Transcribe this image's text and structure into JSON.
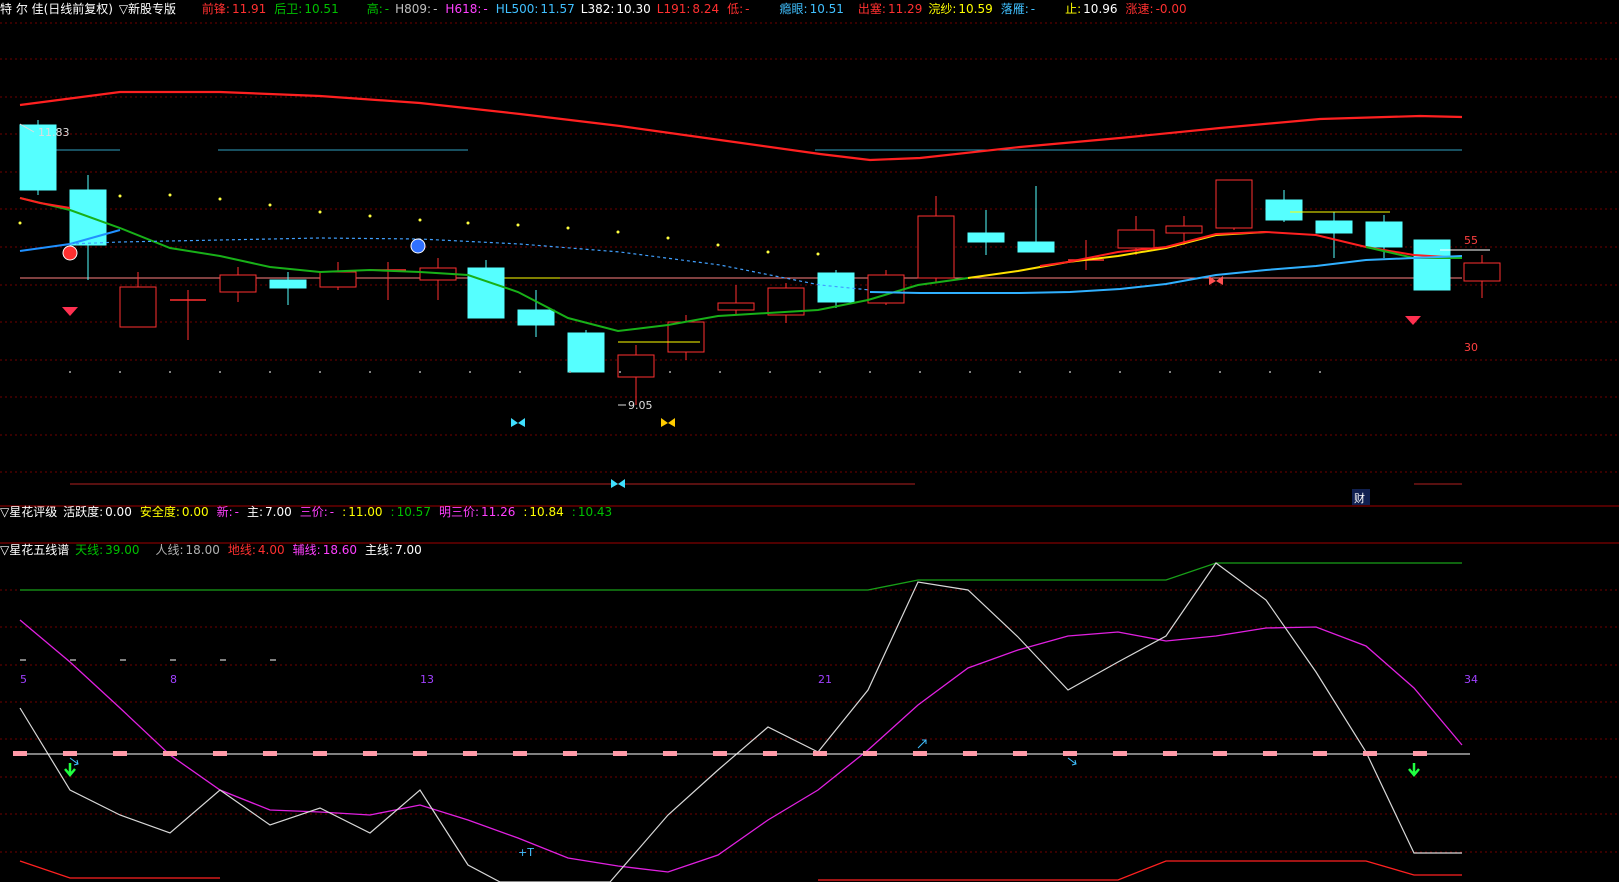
{
  "top_bar": {
    "title": "特 尔 佳(日线前复权)",
    "mode": "▽新股专版",
    "items": [
      {
        "label": "前锋:",
        "value": "11.91",
        "lc": "#ff3030",
        "vc": "#ff3030"
      },
      {
        "label": "后卫:",
        "value": "10.51",
        "lc": "#00c000",
        "vc": "#00c000"
      },
      {
        "label": "高:",
        "value": "-",
        "lc": "#00c000",
        "vc": "#00c000"
      },
      {
        "label": "H809:",
        "value": "-",
        "lc": "#c0c0c0",
        "vc": "#c0c0c0"
      },
      {
        "label": "H618:",
        "value": "-",
        "lc": "#ff40ff",
        "vc": "#ff40ff"
      },
      {
        "label": "HL500:",
        "value": "11.57",
        "lc": "#40c0ff",
        "vc": "#40c0ff"
      },
      {
        "label": "L382:",
        "value": "10.30",
        "lc": "#ffffff",
        "vc": "#ffffff"
      },
      {
        "label": "L191:",
        "value": "8.24",
        "lc": "#ff3030",
        "vc": "#ff3030"
      },
      {
        "label": "低:",
        "value": "-",
        "lc": "#ff3030",
        "vc": "#ff3030"
      },
      {
        "label": "瘾眼:",
        "value": "10.51",
        "lc": "#40c0ff",
        "vc": "#40c0ff"
      },
      {
        "label": "出塞:",
        "value": "11.29",
        "lc": "#ff3030",
        "vc": "#ff3030"
      },
      {
        "label": "浣纱:",
        "value": "10.59",
        "lc": "#ffff00",
        "vc": "#ffff00"
      },
      {
        "label": "落雁:",
        "value": "-",
        "lc": "#40c0ff",
        "vc": "#40c0ff"
      },
      {
        "label": "止:",
        "value": "10.96",
        "lc": "#ffff00",
        "vc": "#ffffff"
      },
      {
        "label": "涨速:",
        "value": "-0.00",
        "lc": "#ff3030",
        "vc": "#ff3030"
      }
    ]
  },
  "main_chart": {
    "high_label": "11.83",
    "low_label": "9.05",
    "right_scale_upper": "55",
    "right_scale_lower": "30",
    "cai_marker": "财"
  },
  "pane1": {
    "title": "▽星花评级",
    "items": [
      {
        "label": "活跃度:",
        "value": "0.00",
        "lc": "#ffffff",
        "vc": "#ffffff"
      },
      {
        "label": "安全度:",
        "value": "0.00",
        "lc": "#ffff00",
        "vc": "#ffff00"
      },
      {
        "label": "新:",
        "value": "-",
        "lc": "#ff40ff",
        "vc": "#ff40ff"
      },
      {
        "label": "主:",
        "value": "7.00",
        "lc": "#ffffff",
        "vc": "#ffffff"
      },
      {
        "label": "三价:",
        "value": "-",
        "lc": "#ff40ff",
        "vc": "#ff40ff"
      },
      {
        "label": ":",
        "value": "11.00",
        "lc": "#ffff00",
        "vc": "#ffff00"
      },
      {
        "label": ":",
        "value": "10.57",
        "lc": "#00c000",
        "vc": "#00c000"
      },
      {
        "label": "明三价:",
        "value": "11.26",
        "lc": "#ff40ff",
        "vc": "#ff40ff"
      },
      {
        "label": ":",
        "value": "10.84",
        "lc": "#ffff00",
        "vc": "#ffff00"
      },
      {
        "label": ":",
        "value": "10.43",
        "lc": "#00c000",
        "vc": "#00c000"
      }
    ]
  },
  "pane2": {
    "title": "▽星花五线谱",
    "items": [
      {
        "label": "天线:",
        "value": "39.00",
        "lc": "#00c000",
        "vc": "#00c000"
      },
      {
        "label": "人线:",
        "value": "18.00",
        "lc": "#b0b0b0",
        "vc": "#b0b0b0"
      },
      {
        "label": "地线:",
        "value": "4.00",
        "lc": "#ff3030",
        "vc": "#ff3030"
      },
      {
        "label": "辅线:",
        "value": "18.60",
        "lc": "#ff40ff",
        "vc": "#ff40ff"
      },
      {
        "label": "主线:",
        "value": "7.00",
        "lc": "#ffffff",
        "vc": "#ffffff"
      }
    ],
    "counts": [
      "5",
      "8",
      "13",
      "21",
      "34"
    ],
    "tag": "+T"
  },
  "colors": {
    "up_red": "#ff3030",
    "down_cyan": "#55ffff",
    "grid_red": "#a00000"
  }
}
